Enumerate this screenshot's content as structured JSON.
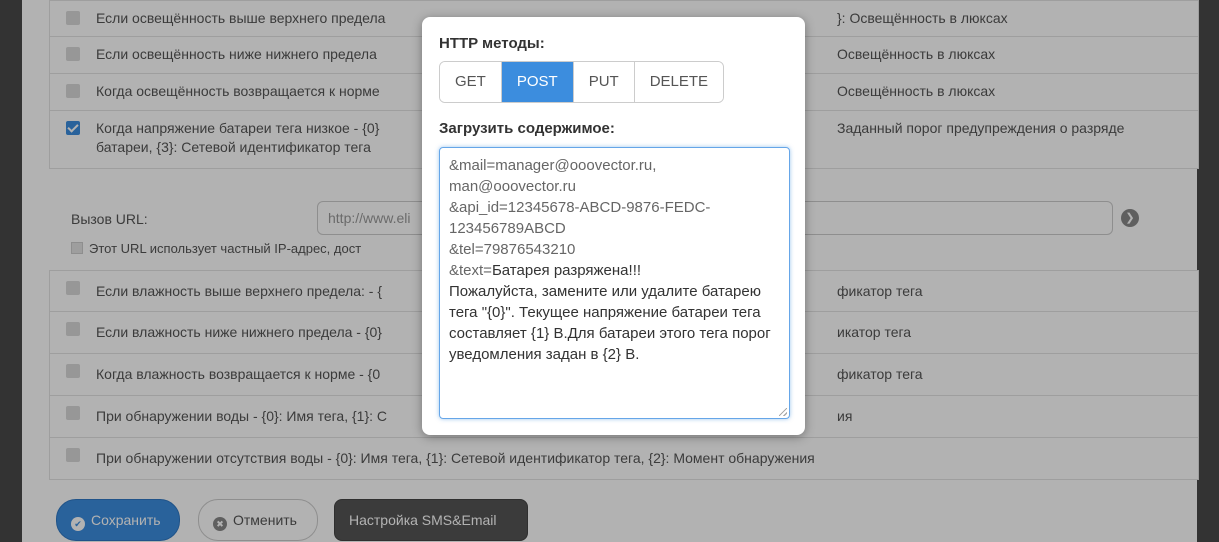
{
  "top_rows": [
    {
      "text": "Если освещённость выше верхнего предела",
      "right": "}: Освещённость в люксах",
      "checked": false
    },
    {
      "text": "Если освещённость ниже нижнего предела",
      "right": "Освещённость в люксах",
      "checked": false
    },
    {
      "text": "Когда освещённость возвращается к норме",
      "right": "Освещённость в люксах",
      "checked": false
    },
    {
      "text": "Когда напряжение батареи тега низкое - {0}",
      "text2": "батареи, {3}: Сетевой идентификатор тега",
      "right": "Заданный порог предупреждения о разряде",
      "checked": true
    }
  ],
  "url": {
    "label": "Вызов URL:",
    "value": "http://www.eli",
    "note": "Этот URL использует частный IP-адрес, дост"
  },
  "bottom_rows": [
    {
      "text": "Если влажность выше верхнего предела: - {",
      "right": "фикатор тега"
    },
    {
      "text": "Если влажность ниже нижнего предела - {0}",
      "right": "икатор тега"
    },
    {
      "text": "Когда влажность возвращается к норме - {0",
      "right": "фикатор тега"
    },
    {
      "text": "При обнаружении воды - {0}: Имя тега, {1}: С",
      "right": "ия"
    },
    {
      "text": "При обнаружении отсутствия воды - {0}: Имя тега, {1}: Сетевой идентификатор тега, {2}: Момент обнаружения",
      "right": ""
    }
  ],
  "buttons": {
    "save": "Сохранить",
    "cancel": "Отменить",
    "sms": "Настройка SMS&Email"
  },
  "modal": {
    "methods_title": "HTTP методы:",
    "methods": [
      "GET",
      "POST",
      "PUT",
      "DELETE"
    ],
    "selected_method": "POST",
    "payload_label": "Загрузить содержимое:",
    "payload_muted": "&mail=manager@ooovector.ru,\nman@ooovector.ru\n&api_id=12345678-ABCD-9876-FEDC-\n123456789ABCD\n&tel=79876543210\n&text=",
    "payload_text": "Батарея разряжена!!!\nПожалуйста, замените или удалите батарею тега \"{0}\". Текущее напряжение батареи тега составляет {1} В.Для батареи этого тега порог уведомления задан в {2} В."
  },
  "colors": {
    "accent": "#3c8dde",
    "overlay": "rgba(0,0,0,0.30)"
  }
}
